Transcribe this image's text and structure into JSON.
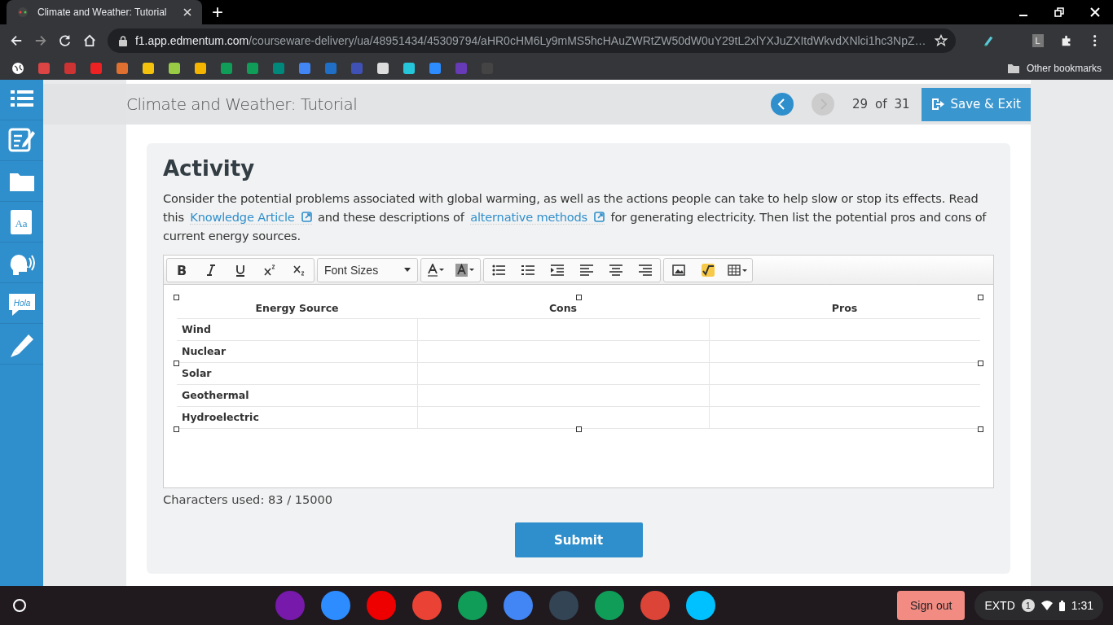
{
  "browser": {
    "tab_title": "Climate and Weather: Tutorial",
    "new_tab": "+",
    "url_host": "f1.app.edmentum.com",
    "url_path": "/courseware-delivery/ua/48951434/45309794/aHR0cHM6Ly9mMS5hcHAuZWRtZW50dW0uY29tL2xlYXJuZXItdWkvdXNlci1hc3NpZ…",
    "profile": "L",
    "other_bookmarks": "Other bookmarks"
  },
  "sidebar": {
    "dictionary_label": "Aa",
    "chat_label": "Hola"
  },
  "header": {
    "title": "Climate and Weather: Tutorial",
    "current": "29",
    "of": "of",
    "total": "31",
    "save_exit": "Save & Exit"
  },
  "activity": {
    "heading": "Activity",
    "paragraph": [
      {
        "kind": "text",
        "text": "Consider the potential problems associated with global warming, as well as the actions people can take to help slow or stop its effects. Read this "
      },
      {
        "kind": "link",
        "text": "Knowledge Article"
      },
      {
        "kind": "text",
        "text": " and these descriptions of "
      },
      {
        "kind": "link",
        "text": "alternative methods"
      },
      {
        "kind": "text",
        "text": " for generating electricity. Then list the potential pros and cons of current energy sources."
      }
    ],
    "editor": {
      "bold": "B",
      "font_sizes": "Font Sizes",
      "columns": [
        "Energy Source",
        "Cons",
        "Pros"
      ],
      "rows": [
        [
          "Wind",
          "",
          ""
        ],
        [
          "Nuclear",
          "",
          ""
        ],
        [
          "Solar",
          "",
          ""
        ],
        [
          "Geothermal",
          "",
          ""
        ],
        [
          "Hydroelectric",
          "",
          ""
        ]
      ]
    },
    "characters_used": "Characters used: 83 / 15000",
    "submit": "Submit"
  },
  "taskbar": {
    "sign_out": "Sign out",
    "status": "EXTD",
    "notifications": "1",
    "time": "1:31"
  }
}
